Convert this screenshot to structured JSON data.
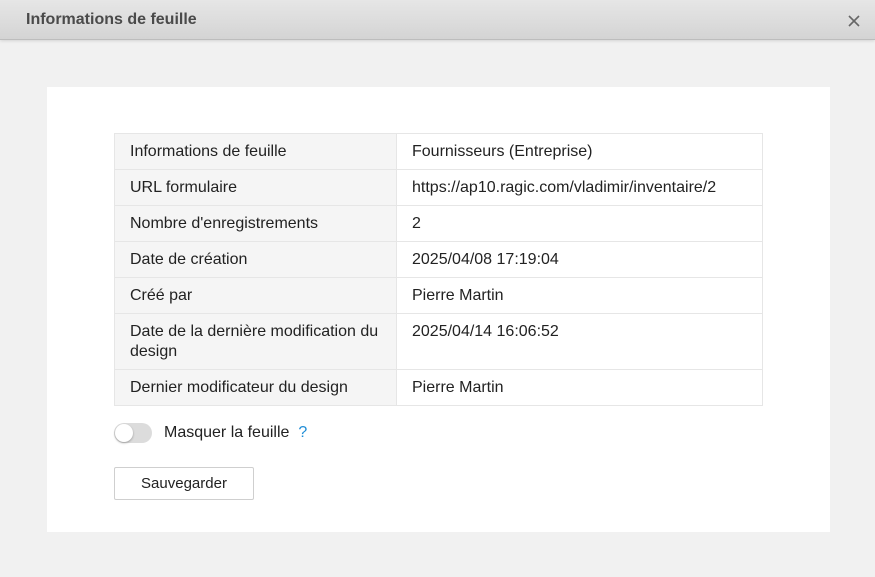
{
  "dialog": {
    "title": "Informations de feuille"
  },
  "info_table": {
    "rows": [
      {
        "label": "Informations de feuille",
        "value": "Fournisseurs (Entreprise)"
      },
      {
        "label": "URL formulaire",
        "value": "https://ap10.ragic.com/vladimir/inventaire/2"
      },
      {
        "label": "Nombre d'enregistrements",
        "value": "2"
      },
      {
        "label": "Date de création",
        "value": "2025/04/08 17:19:04"
      },
      {
        "label": "Créé par",
        "value": "Pierre Martin"
      },
      {
        "label": "Date de la dernière modification du design",
        "value": "2025/04/14 16:06:52"
      },
      {
        "label": "Dernier modificateur du design",
        "value": "Pierre Martin"
      }
    ]
  },
  "hide_sheet": {
    "label": "Masquer la feuille",
    "enabled": false,
    "help": "?"
  },
  "actions": {
    "save_label": "Sauvegarder"
  },
  "colors": {
    "help_link": "#1f8dd6",
    "toggle_off": "#dcdcdc"
  }
}
